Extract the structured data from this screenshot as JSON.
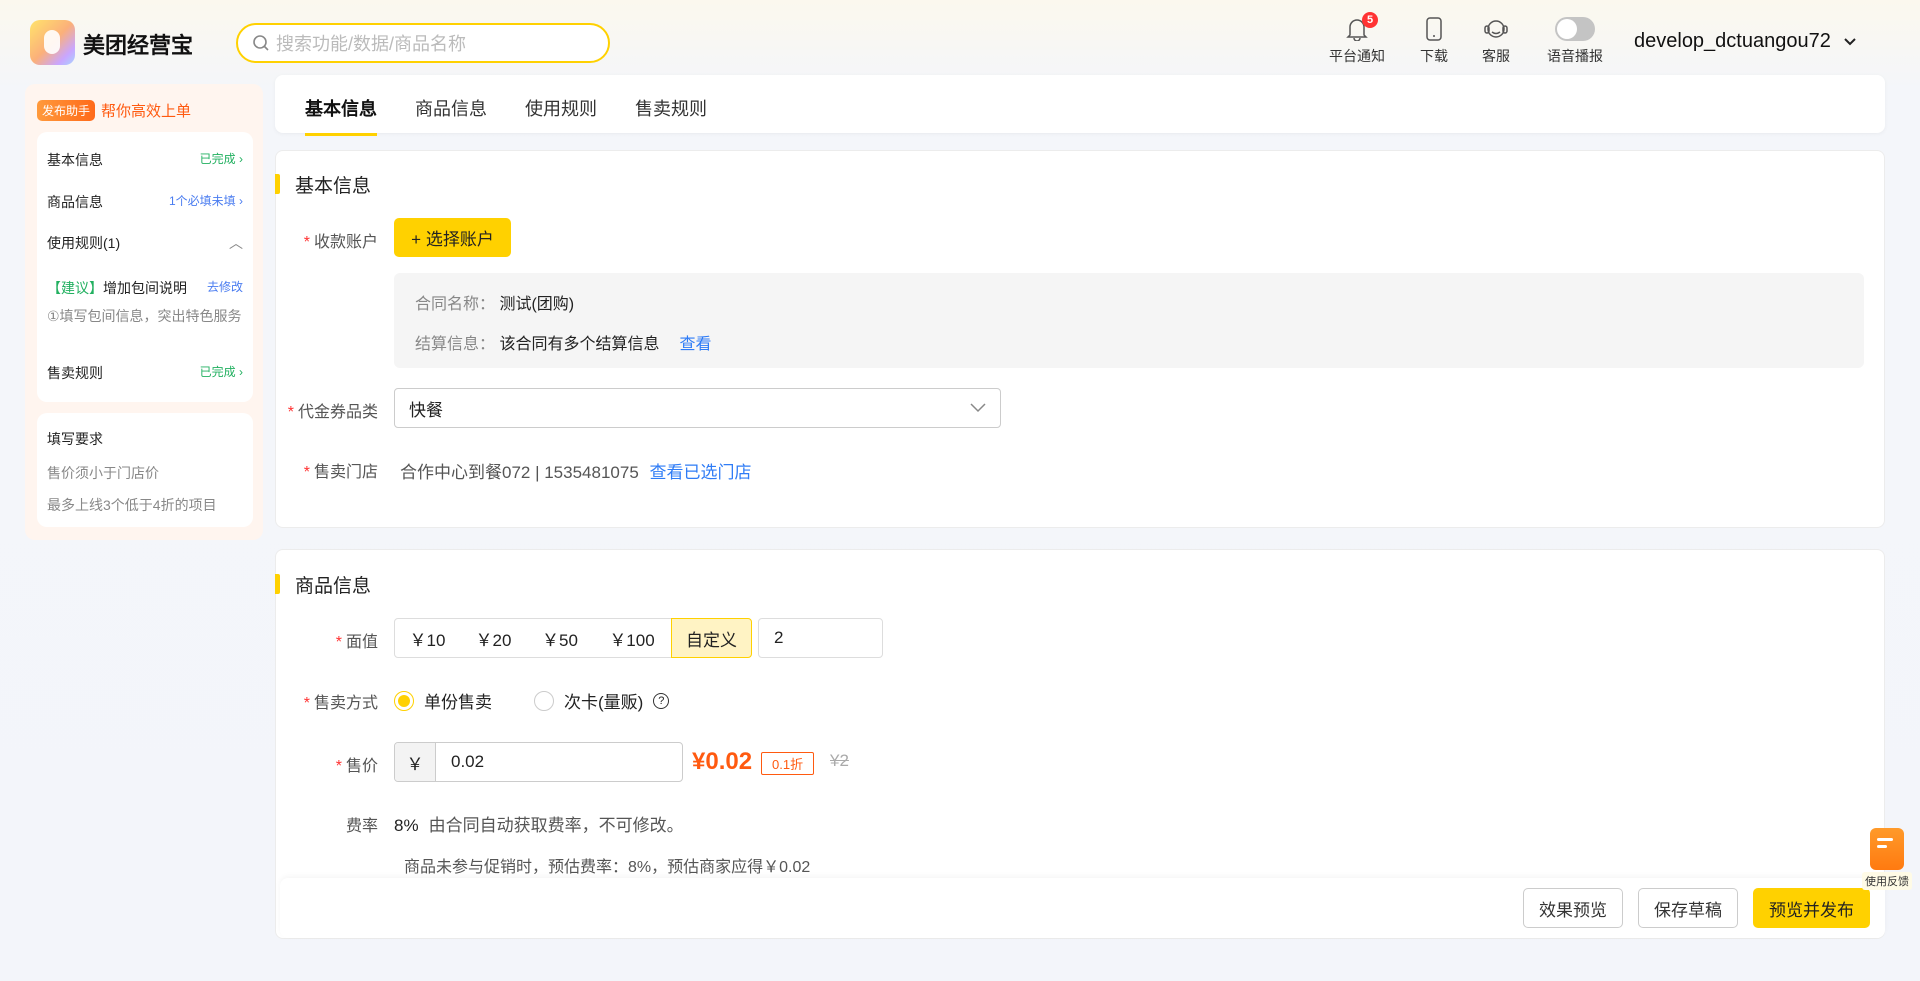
{
  "header": {
    "brand": "美团经营宝",
    "search_placeholder": "搜索功能/数据/商品名称",
    "notify_label": "平台通知",
    "notify_count": "5",
    "download_label": "下载",
    "service_label": "客服",
    "voice_label": "语音播报",
    "voice_on": false,
    "username": "develop_dctuangou72"
  },
  "sidebar": {
    "helper_tag": "发布助手",
    "helper_text": "帮你高效上单",
    "items": [
      {
        "label": "基本信息",
        "status": "已完成",
        "color": "#22b060"
      },
      {
        "label": "商品信息",
        "status": "1个必填未填",
        "color": "#4a7cf0"
      },
      {
        "label": "使用规则(1)"
      },
      {
        "label": "售卖规则",
        "status": "已完成",
        "color": "#22b060"
      }
    ],
    "suggest_tag": "【建议】",
    "suggest_title": "增加包间说明",
    "suggest_action": "去修改",
    "suggest_desc": "①填写包间信息，突出特色服务",
    "req_title": "填写要求",
    "req_items": [
      "售价须小于门店价",
      "最多上线3个低于4折的项目"
    ]
  },
  "tabs": [
    "基本信息",
    "商品信息",
    "使用规则",
    "售卖规则"
  ],
  "basic": {
    "title": "基本信息",
    "account_label": "收款账户",
    "account_btn": "+ 选择账户",
    "contract_label": "合同名称：",
    "contract_value": "测试(团购)",
    "settle_label": "结算信息：",
    "settle_value": "该合同有多个结算信息",
    "settle_link": "查看",
    "category_label": "代金券品类",
    "category_value": "快餐",
    "store_label": "售卖门店",
    "store_value": "合作中心到餐072 | 1535481075",
    "store_link": "查看已选门店"
  },
  "product": {
    "title": "商品信息",
    "face_label": "面值",
    "face_options": [
      "￥10",
      "￥20",
      "￥50",
      "￥100",
      "自定义"
    ],
    "face_custom": "2",
    "mode_label": "售卖方式",
    "mode_options": [
      "单份售卖",
      "次卡(量贩)"
    ],
    "price_label": "售价",
    "price_prefix": "￥",
    "price_value": "0.02",
    "price_display": "¥0.02",
    "discount": "0.1折",
    "orig_price": "¥2",
    "fee_label": "费率",
    "fee_value": "8%",
    "fee_desc": "由合同自动获取费率，不可修改。",
    "fee_note": "商品未参与促销时，预估费率：8%，预估商家应得￥0.02"
  },
  "footer": {
    "preview": "效果预览",
    "draft": "保存草稿",
    "publish": "预览并发布"
  },
  "feedback": "使用反馈"
}
